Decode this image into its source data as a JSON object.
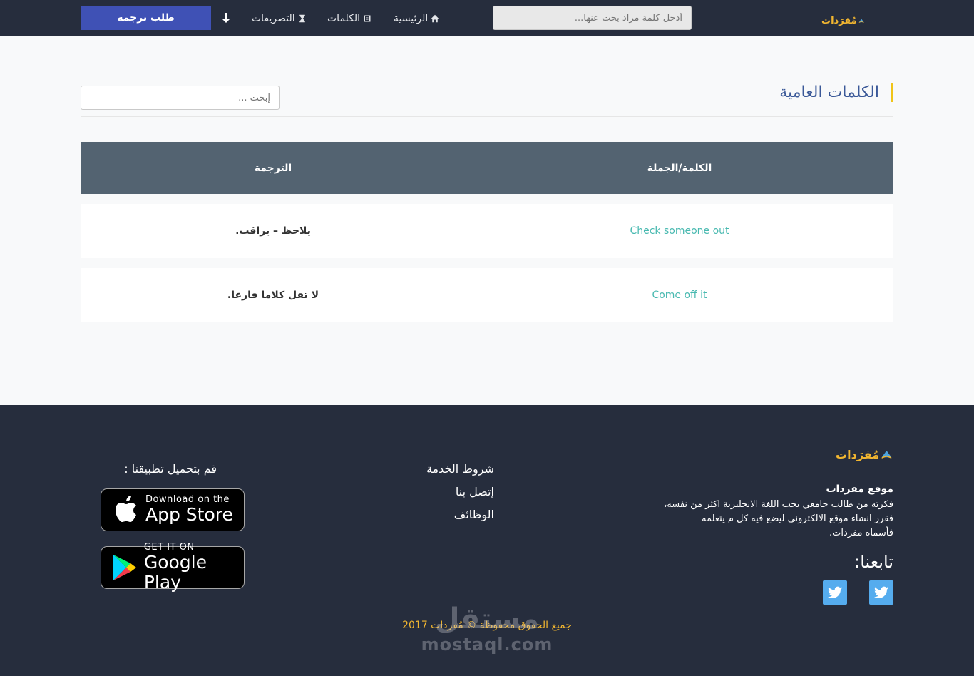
{
  "navbar": {
    "logo_text": "مُفرَدات",
    "search_placeholder": "أدخل كلمة مراد بحث عنها...",
    "home_label": "الرئيسية",
    "words_label": "الكلمات",
    "conjugations_label": "التصريفات",
    "request_label": "طلب ترجمة"
  },
  "main": {
    "section_title": "الكلمات العامية",
    "search_placeholder": "إبحث ...",
    "table": {
      "headers": {
        "word": "الكلمة/الجملة",
        "translation": "الترجمة"
      },
      "rows": [
        {
          "word": "Check someone out",
          "translation": "يلاحظ – يراقب."
        },
        {
          "word": "Come off it",
          "translation": "لا تقل كلاما فارغا."
        }
      ]
    }
  },
  "footer": {
    "logo_text": "مُفرَدات",
    "about_title": "موقع مفردات",
    "about_lines": [
      "فكرته من طالب جامعي يحب اللغة الانجليزية اكثر من نفسه،",
      "فقرر انشاء موقع الالكتروني ليضع فيه كل م يتعلمه",
      "فأسماه مفردات."
    ],
    "follow_title": "تابعنا:",
    "links": [
      "شروط الخدمة",
      "إتصل بنا",
      "الوظائف"
    ],
    "app_title": "قم بتحميل تطبيقنا :",
    "app_store": {
      "small": "Download on the",
      "big": "App Store"
    },
    "google_play": {
      "small": "GET IT ON",
      "big": "Google Play"
    },
    "copyright": "جميع الحقوق محفوظة © مُفردات 2017"
  },
  "watermark": {
    "arabic": "مستقل",
    "latin": "mostaql.com"
  },
  "colors": {
    "navbar_bg": "#262d3d",
    "request_button": "#3f51b5",
    "accent_yellow": "#f0c418",
    "table_header": "#536371",
    "word_teal": "#48b9b0",
    "twitter_blue": "#55acee"
  }
}
